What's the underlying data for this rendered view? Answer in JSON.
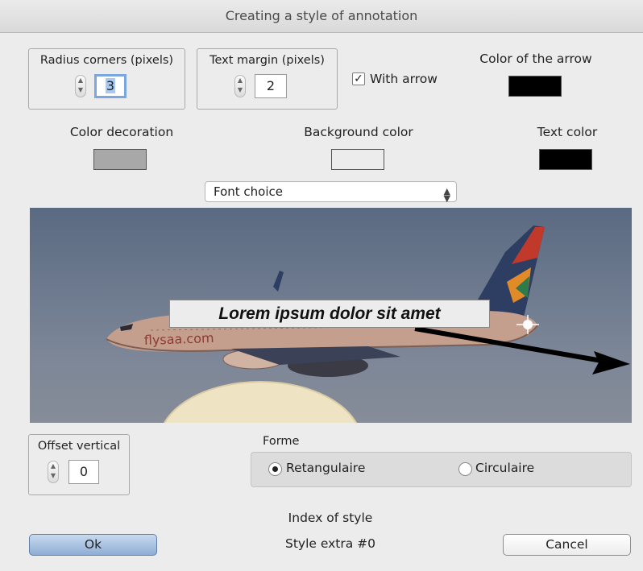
{
  "window": {
    "title": "Creating a style of annotation"
  },
  "radius": {
    "label": "Radius corners (pixels)",
    "value": "3"
  },
  "text_margin": {
    "label": "Text margin (pixels)",
    "value": "2"
  },
  "with_arrow": {
    "label": "With arrow",
    "checked": true
  },
  "arrow_color": {
    "label": "Color of the arrow",
    "color": "#000000"
  },
  "decoration_color": {
    "label": "Color decoration",
    "color": "#a8a8a8"
  },
  "background_color": {
    "label": "Background color",
    "color": "#ececec"
  },
  "text_color": {
    "label": "Text color",
    "color": "#000000"
  },
  "font": {
    "label": "Font choice"
  },
  "preview": {
    "annotation_text": "Lorem ipsum dolor sit amet",
    "plane_text": "flysaa.com"
  },
  "offset_vertical": {
    "label": "Offset vertical",
    "value": "0"
  },
  "forme": {
    "label": "Forme",
    "options": [
      {
        "label": "Retangulaire",
        "selected": true
      },
      {
        "label": "Circulaire",
        "selected": false
      }
    ]
  },
  "index_of_style": {
    "label": "Index of style",
    "value": "Style extra #0"
  },
  "buttons": {
    "ok": "Ok",
    "cancel": "Cancel"
  }
}
